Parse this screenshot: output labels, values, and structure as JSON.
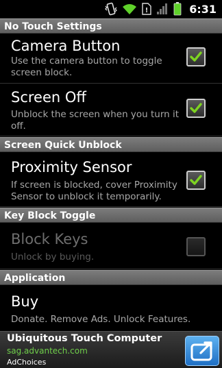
{
  "status_bar": {
    "time": "6:31",
    "icons": [
      "vibrate-icon",
      "wifi-icon",
      "no-sim-icon",
      "signal-icon",
      "battery-icon"
    ]
  },
  "sections": {
    "no_touch": {
      "header": "No Touch Settings",
      "camera_button": {
        "title": "Camera Button",
        "summary": "Use the camera button to toggle screen block.",
        "checked": true
      },
      "screen_off": {
        "title": "Screen Off",
        "summary": "Unblock the screen when you turn it off.",
        "checked": true
      }
    },
    "quick_unblock": {
      "header": "Screen Quick Unblock",
      "proximity_sensor": {
        "title": "Proximity Sensor",
        "summary": "If screen is blocked, cover Proximity Sensor to unblock it temporarily.",
        "checked": true
      }
    },
    "key_block": {
      "header": "Key Block Toggle",
      "block_keys": {
        "title": "Block Keys",
        "summary": "Unlock by buying.",
        "checked": false,
        "enabled": false
      }
    },
    "application": {
      "header": "Application",
      "buy": {
        "title": "Buy",
        "summary": "Donate. Remove Ads. Unlock Features."
      }
    }
  },
  "ad": {
    "title": "Ubiquitous Touch Computer",
    "url": "sag.advantech.com",
    "choices": "AdChoices"
  },
  "colors": {
    "checkmark": "#7ed321",
    "header_bg": "#6b6b6b",
    "summary_text": "#a8a8a8",
    "ad_url": "#6fcf4a",
    "ad_button": "#2f8be0"
  }
}
